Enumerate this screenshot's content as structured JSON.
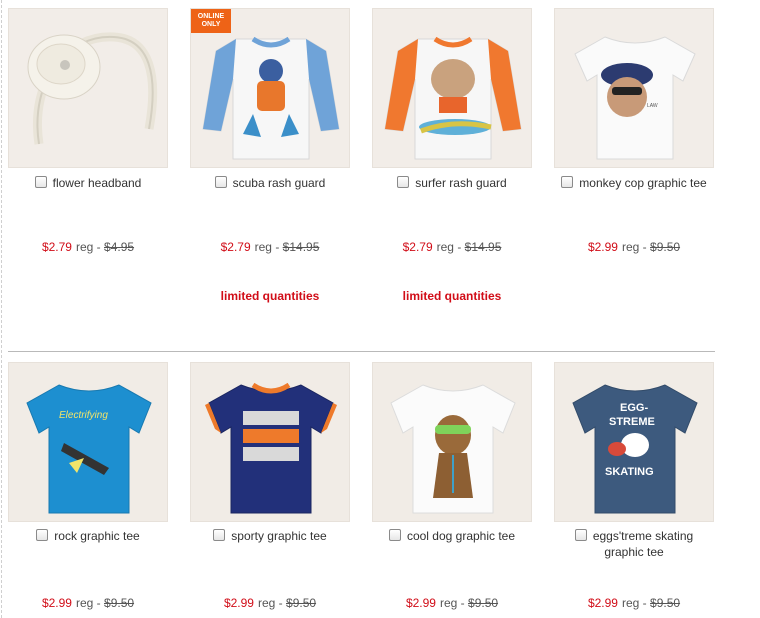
{
  "products_row1": [
    {
      "name": "flower headband",
      "sale_price": "$2.79",
      "reg_label": "reg -",
      "reg_price": "$4.95",
      "note": ""
    },
    {
      "name": "scuba rash guard",
      "sale_price": "$2.79",
      "reg_label": "reg -",
      "reg_price": "$14.95",
      "note": "limited quantities",
      "badge": "ONLINE ONLY"
    },
    {
      "name": "surfer rash guard",
      "sale_price": "$2.79",
      "reg_label": "reg -",
      "reg_price": "$14.95",
      "note": "limited quantities"
    },
    {
      "name": "monkey cop graphic tee",
      "sale_price": "$2.99",
      "reg_label": "reg -",
      "reg_price": "$9.50",
      "note": ""
    }
  ],
  "products_row2": [
    {
      "name": "rock graphic tee",
      "sale_price": "$2.99",
      "reg_label": "reg -",
      "reg_price": "$9.50"
    },
    {
      "name": "sporty graphic tee",
      "sale_price": "$2.99",
      "reg_label": "reg -",
      "reg_price": "$9.50"
    },
    {
      "name": "cool dog graphic tee",
      "sale_price": "$2.99",
      "reg_label": "reg -",
      "reg_price": "$9.50"
    },
    {
      "name": "eggs'treme skating graphic tee",
      "sale_price": "$2.99",
      "reg_label": "reg -",
      "reg_price": "$9.50"
    }
  ],
  "colors": {
    "sale": "#d10d18",
    "badge": "#ee6317",
    "divider": "#b9b9b9"
  }
}
